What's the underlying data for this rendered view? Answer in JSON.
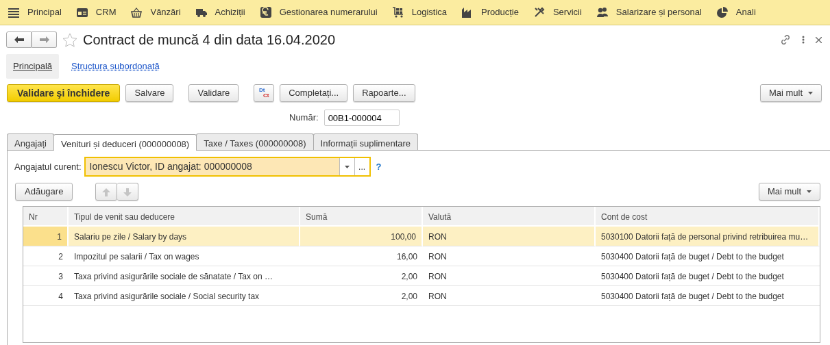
{
  "menu": [
    {
      "label": "Principal"
    },
    {
      "label": "CRM"
    },
    {
      "label": "Vânzări"
    },
    {
      "label": "Achiziții"
    },
    {
      "label": "Gestionarea numerarului"
    },
    {
      "label": "Logistica"
    },
    {
      "label": "Producție"
    },
    {
      "label": "Servicii"
    },
    {
      "label": "Salarizare și personal"
    },
    {
      "label": "Anali"
    }
  ],
  "title": "Contract de muncă 4 din data 16.04.2020",
  "favorite": false,
  "form_nav": [
    {
      "label": "Principală",
      "selected": true
    },
    {
      "label": "Structura subordonată",
      "selected": false
    }
  ],
  "command_bar": {
    "buttons": [
      {
        "kind": "primary",
        "label": "Validare şi închidere"
      },
      {
        "kind": "plain",
        "label": "Salvare"
      },
      {
        "kind": "plain",
        "label": "Validare"
      },
      {
        "kind": "dtct",
        "top": "Dt",
        "bottom": "Ct"
      },
      {
        "kind": "plain",
        "label": "Completați..."
      },
      {
        "kind": "plain",
        "label": "Rapoarte..."
      }
    ],
    "more": "Mai mult"
  },
  "number": {
    "label": "Număr:",
    "value": "00B1-000004"
  },
  "tabs": [
    {
      "label": "Angajați",
      "selected": false
    },
    {
      "label": "Venituri și deduceri (000000008)",
      "selected": true
    },
    {
      "label": "Taxe / Taxes (000000008)",
      "selected": false
    },
    {
      "label": "Informații suplimentare",
      "selected": false
    }
  ],
  "employee": {
    "label": "Angajatul curent:",
    "value": "Ionescu Victor, ID angajat: 000000008",
    "select": "...",
    "help": "?"
  },
  "table_toolbar": {
    "add": "Adăugare",
    "move_disabled": true,
    "more": "Mai mult"
  },
  "table": {
    "columns": [
      "Nr",
      "Tipul de venit sau deducere",
      "Sumă",
      "Valută",
      "Cont de cost"
    ],
    "rows": [
      {
        "nr": "1",
        "type": "Salariu pe zile / Salary by days",
        "sum": "100,00",
        "currency": "RON",
        "account": "5030100 Datorii față de personal privind retribuirea mu…",
        "selected": true
      },
      {
        "nr": "2",
        "type": "Impozitul pe salarii / Tax on wages",
        "sum": "16,00",
        "currency": "RON",
        "account": "5030400 Datorii față de buget / Debt to the budget",
        "selected": false
      },
      {
        "nr": "3",
        "type": "Taxa privind asigurările sociale de sănatate / Tax on …",
        "sum": "2,00",
        "currency": "RON",
        "account": "5030400 Datorii față de buget / Debt to the budget",
        "selected": false
      },
      {
        "nr": "4",
        "type": "Taxa privind asigurările sociale / Social security tax",
        "sum": "2,00",
        "currency": "RON",
        "account": "5030400 Datorii față de buget / Debt to the budget",
        "selected": false
      }
    ]
  }
}
